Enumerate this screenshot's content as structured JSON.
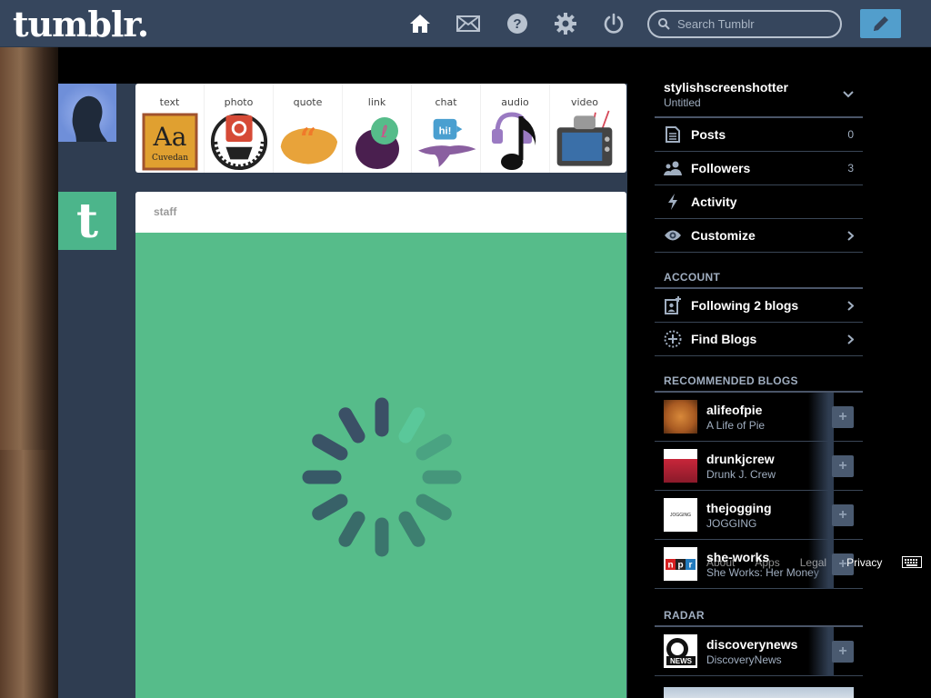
{
  "header": {
    "logo": "tumblr.",
    "search_placeholder": "Search Tumblr",
    "icons": [
      "home-icon",
      "mail-icon",
      "help-icon",
      "gear-icon",
      "power-icon"
    ],
    "compose_icon": "pencil-icon"
  },
  "post_types": [
    {
      "label": "text",
      "icon": "text-icon"
    },
    {
      "label": "photo",
      "icon": "camera-icon"
    },
    {
      "label": "quote",
      "icon": "quote-icon"
    },
    {
      "label": "link",
      "icon": "link-icon"
    },
    {
      "label": "chat",
      "icon": "chat-icon"
    },
    {
      "label": "audio",
      "icon": "headphones-icon"
    },
    {
      "label": "video",
      "icon": "video-icon"
    }
  ],
  "post": {
    "author": "staff"
  },
  "sidebar": {
    "blog_name": "stylishscreenshotter",
    "blog_title": "Untitled",
    "items": [
      {
        "label": "Posts",
        "count": "0"
      },
      {
        "label": "Followers",
        "count": "3"
      },
      {
        "label": "Activity",
        "count": ""
      },
      {
        "label": "Customize",
        "count": ""
      }
    ],
    "account_title": "ACCOUNT",
    "account_items": [
      {
        "label": "Following 2 blogs"
      },
      {
        "label": "Find Blogs"
      }
    ],
    "recommended_title": "RECOMMENDED BLOGS",
    "recommended": [
      {
        "name": "alifeofpie",
        "desc": "A Life of Pie"
      },
      {
        "name": "drunkjcrew",
        "desc": "Drunk J. Crew"
      },
      {
        "name": "thejogging",
        "desc": "JOGGING"
      },
      {
        "name": "she-works",
        "desc": "She Works: Her Money"
      }
    ],
    "radar_title": "RADAR",
    "radar": {
      "name": "discoverynews",
      "desc": "DiscoveryNews"
    },
    "footer_links": [
      "About",
      "Apps",
      "Legal",
      "Privacy"
    ]
  },
  "colors": {
    "header_bg": "#36465d",
    "accent_blue": "#529ecc",
    "staff_green": "#56bc8a"
  }
}
